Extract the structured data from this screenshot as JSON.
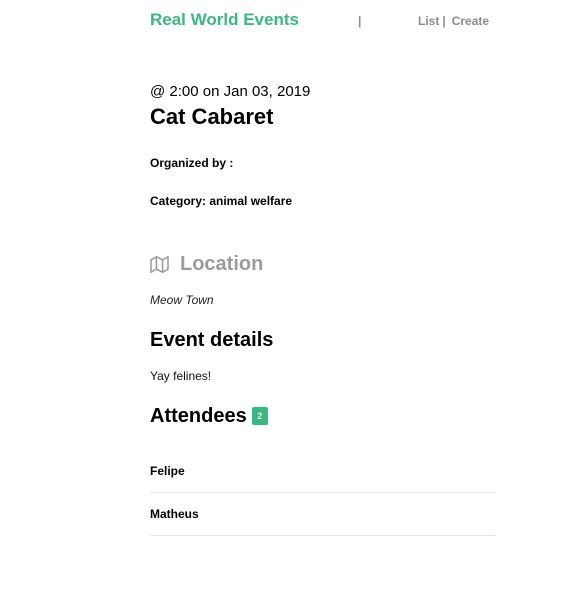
{
  "header": {
    "brand": "Real World Events",
    "nav_separator": "|",
    "nav_list": "List",
    "nav_list_separator": "|",
    "nav_create": "Create"
  },
  "event": {
    "time": "@ 2:00 on Jan 03, 2019",
    "title": "Cat Cabaret",
    "organized_by": "Organized by :",
    "category": "Category: animal welfare"
  },
  "location": {
    "heading": "Location",
    "icon": "map-icon",
    "text": "Meow Town"
  },
  "details": {
    "heading": "Event details",
    "text": "Yay felines!"
  },
  "attendees": {
    "heading": "Attendees",
    "count": "2",
    "items": [
      {
        "name": "Felipe"
      },
      {
        "name": "Matheus"
      }
    ]
  },
  "colors": {
    "brand": "#39b982",
    "muted": "#8c8c8c"
  }
}
